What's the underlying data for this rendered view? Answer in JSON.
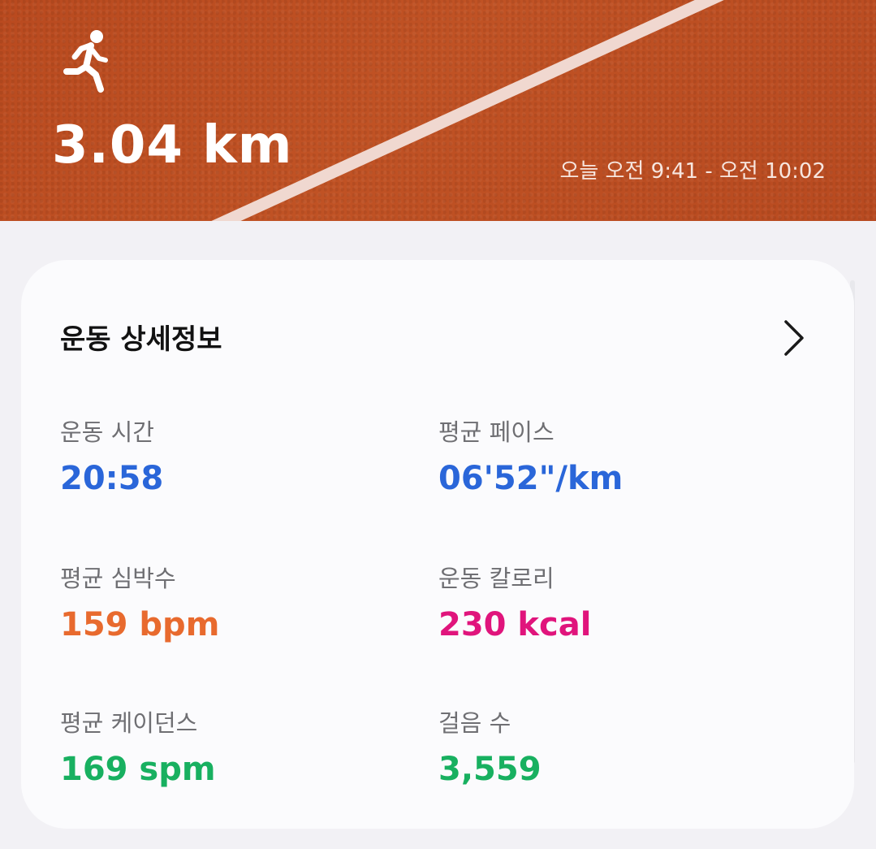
{
  "hero": {
    "distance": "3.04 km",
    "time_range": "오늘 오전 9:41 - 오전 10:02",
    "icon": "running-person-icon"
  },
  "details": {
    "title": "운동 상세정보",
    "chevron_icon": "chevron-right-icon",
    "stats": [
      {
        "label": "운동 시간",
        "value": "20:58",
        "color": "#2a66d9"
      },
      {
        "label": "평균 페이스",
        "value": "06'52\"/km",
        "color": "#2a66d9"
      },
      {
        "label": "평균 심박수",
        "value": "159 bpm",
        "color": "#e86a2e"
      },
      {
        "label": "운동 칼로리",
        "value": "230 kcal",
        "color": "#e0147c"
      },
      {
        "label": "평균 케이던스",
        "value": "169 spm",
        "color": "#18b060"
      },
      {
        "label": "걸음 수",
        "value": "3,559",
        "color": "#18b060"
      }
    ]
  }
}
